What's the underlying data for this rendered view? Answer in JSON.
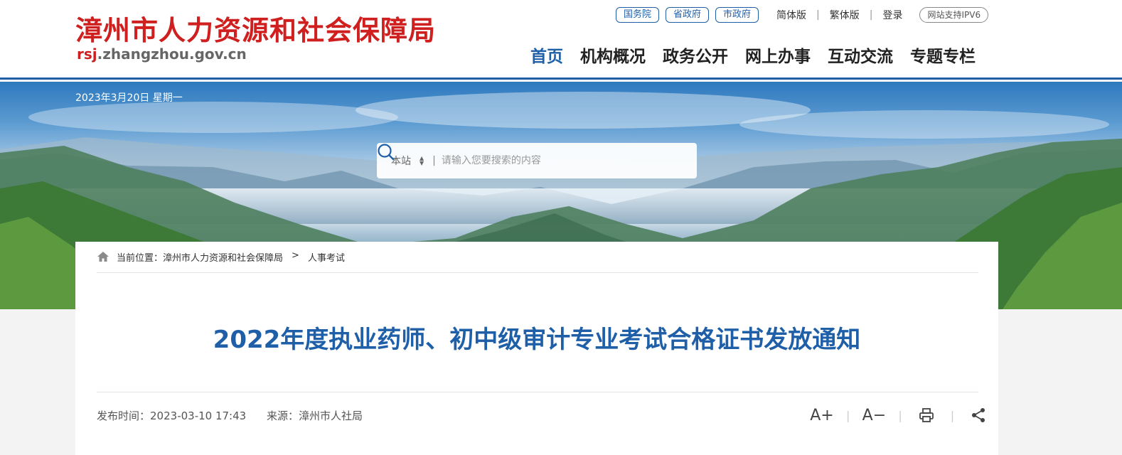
{
  "header": {
    "site_name": "漳州市人力资源和社会保障局",
    "site_url_prefix": "rsj",
    "site_url_rest": ".zhangzhou.gov.cn",
    "top_links": [
      {
        "label": "国务院"
      },
      {
        "label": "省政府"
      },
      {
        "label": "市政府"
      }
    ],
    "simplified": "简体版",
    "traditional": "繁体版",
    "login": "登录",
    "ipv6": "网站支持IPV6",
    "nav": [
      {
        "label": "首页",
        "active": true
      },
      {
        "label": "机构概况",
        "active": false
      },
      {
        "label": "政务公开",
        "active": false
      },
      {
        "label": "网上办事",
        "active": false
      },
      {
        "label": "互动交流",
        "active": false
      },
      {
        "label": "专题专栏",
        "active": false
      }
    ]
  },
  "banner": {
    "date": "2023年3月20日 星期一",
    "search": {
      "scope": "本站",
      "placeholder": "请输入您要搜索的内容",
      "button_icon": "search-icon"
    }
  },
  "article": {
    "breadcrumb": {
      "label": "当前位置：",
      "items": [
        "漳州市人力资源和社会保障局",
        "人事考试"
      ],
      "separator": ">"
    },
    "title": "2022年度执业药师、初中级审计专业考试合格证书发放通知",
    "publish_label": "发布时间：",
    "publish_time": "2023-03-10 17:43",
    "source_label": "来源：",
    "source": "漳州市人社局",
    "tools": {
      "font_larger": "A+",
      "font_smaller": "A−",
      "print_icon": "print-icon",
      "share_icon": "share-icon"
    }
  },
  "colors": {
    "brand_red": "#cf1f1f",
    "brand_blue": "#1f5fa8"
  }
}
